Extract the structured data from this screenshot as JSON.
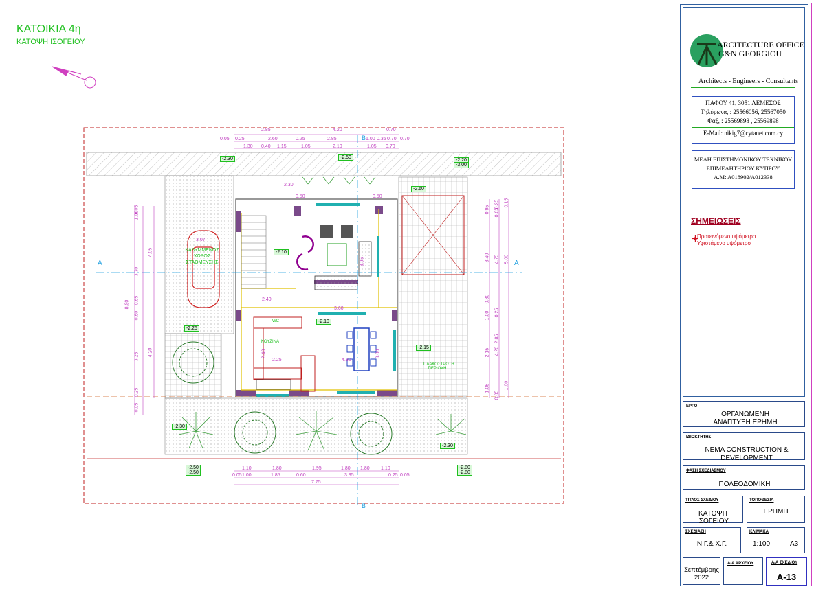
{
  "drawing": {
    "title": "ΚΑΤΟΙΚΙΑ 4η",
    "subtitle": "ΚΑΤΟΨΗ ΙΣΟΓΕΙΟΥ",
    "top_dims_row1": [
      "2.85",
      "4.20",
      "0.70"
    ],
    "top_dims_row2": [
      "0.05",
      "0.25",
      "2.60",
      "0.25",
      "2.85",
      "1.00",
      "0.35",
      "0.70",
      "0.70"
    ],
    "top_dims_row3": [
      "1.30",
      "0.40",
      "1.15",
      "1.05",
      "2.10",
      "1.05",
      "0.70"
    ],
    "bottom_dims_row1": [
      "1.10",
      "1.80",
      "1.95",
      "1.80",
      "1.80",
      "1.10"
    ],
    "bottom_dims_row2": [
      "0.05",
      "1.00",
      "1.85",
      "0.60",
      "3.95",
      "0.25",
      "0.05"
    ],
    "bottom_total": "7.75",
    "left_dims_outer": [
      "8.90"
    ],
    "left_dims_inner": [
      "1.00",
      "0.05",
      "3.70",
      "0.65",
      "0.60",
      "3.25",
      "0.25",
      "0.05"
    ],
    "left_dims_inner2": [
      "4.05",
      "4.20"
    ],
    "right_dims_a": [
      "0.95",
      "3.40",
      "0.80",
      "1.00",
      "2.15",
      "1.05"
    ],
    "right_dims_b": [
      "0.25",
      "0.05",
      "4.75",
      "0.25",
      "2.85",
      "4.20",
      "0.05"
    ],
    "right_dims_c": [
      "0.15",
      "5.00",
      "1.00"
    ],
    "section_a": "A",
    "section_b": "B",
    "levels": [
      "-2.30",
      "-2.50",
      "-2.20",
      "-3.00",
      "-2.60",
      "-2.10",
      "-2.15",
      "-2.25",
      "-2.30",
      "-2.30",
      "-2.50",
      "-2.50",
      "-2.80",
      "-2.80",
      "-2.10"
    ],
    "room_labels": {
      "parking": "ΚΑΛΥΜΜΕΝΟΣ ΧΩΡΟΣ ΣΤΑΘΜΕΥΣΗΣ",
      "kitchen": "ΚΟΥΖΙΝΑ",
      "wc": "WC",
      "living": "ΣΑΛΟΝΙ",
      "patio": "ΠΛΑΚΟΣΤΡΩΤΗ ΠΕΡΙΟΧΗ"
    },
    "interior_dims": [
      "3.07",
      "2.40",
      "3.60",
      "2.25",
      "2.40",
      "3.00",
      "4.30",
      "3.95",
      "2.30",
      "0.50",
      "0.50"
    ]
  },
  "titleblock": {
    "office_line1": "ARCITECTURE OFFICE",
    "office_line2": "G&N GEORGIOU",
    "tagline": "Architects - Engineers - Consultants",
    "address": "ΠΑΦΟΥ 41, 3051 ΛΕΜΕΣΟΣ",
    "phone": "Τηλέφωνα, : 25566056, 25567050",
    "fax": "Φαξ, : 25569898 , 25569898",
    "email": "E-Mail: nikig7@cytanet.com.cy",
    "etek_line1": "ΜΕΛΗ ΕΠΙΣΤΗΜΟΝΙΚΟΥ ΤΕΧΝΙΚΟΥ",
    "etek_line2": "ΕΠΙΜΕΛΗΤΗΡΙΟΥ ΚΥΠΡΟΥ",
    "etek_line3": "Α.Μ: Α018902/Α012338",
    "notes_heading": "ΣΗΜΕΙΩΣΕΙΣ",
    "legend_proposed": "Προτεινόμενο υψόμετρο",
    "legend_existing": "Υφιστάμενο υψόμετρο",
    "project_label": "ΕΡΓΟ",
    "project_value": "ΟΡΓΑΝΩΜΕΝΗ ΑΝΑΠΤΥΞΗ ΕΡΗΜΗ",
    "owner_label": "ΙΔΙΟΚΤΗΤΗΣ",
    "owner_value": "NEMA CONSTRUCTION & DEVELOPMENT",
    "phase_label": "ΦΑΣΗ ΣΧΕΔΙΑΣΜΟΥ",
    "phase_value": "ΠΟΛΕΟΔΟΜΙΚΗ",
    "drawing_title_label": "ΤΙΤΛΟΣ ΣΧΕΔΙΟΥ",
    "drawing_title_value": "ΚΑΤΟΨΗ ΙΣΟΓΕΙΟΥ",
    "location_label": "ΤΟΠΟΘΕΣΙΑ",
    "location_value": "ΕΡΗΜΗ",
    "drawn_label": "ΣΧΕΔΙΑΣΗ",
    "drawn_value": "Ν.Γ.& Χ.Γ.",
    "scale_label": "ΚΛΙΜΑΚΑ",
    "scale_value": "1:100",
    "paper": "A3",
    "date_value": "Σεπτέμβρης 2022",
    "file_label": "Α/Α ΑΡΧΕΙΟΥ",
    "sheet_label": "Α/Α ΣΧΕΔΙΟΥ",
    "sheet_value": "A-13"
  },
  "colors": {
    "green_text": "#20c020",
    "dim_magenta": "#c040c0",
    "site_red": "#c02020",
    "section_cyan": "#20a0e0",
    "wall_yellow": "#e0c000",
    "title_blue": "#2a4a8a"
  }
}
